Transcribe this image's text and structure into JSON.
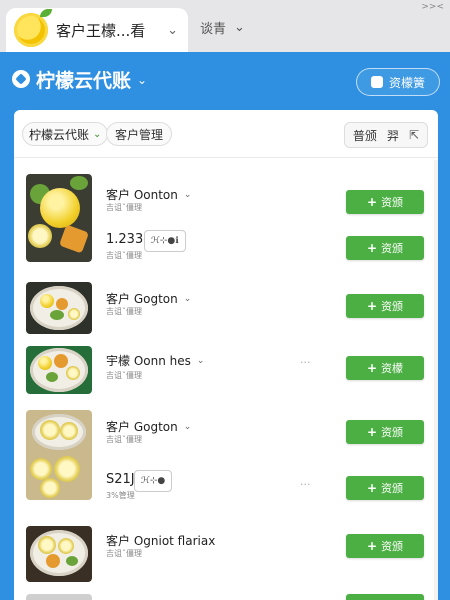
{
  "tabs": {
    "active_title": "客户王檬...看",
    "second_title": "谈青",
    "window_btn": ">><"
  },
  "header": {
    "title": "柠檬云代账",
    "action_label": "资檬簧"
  },
  "toolbar": {
    "filter_label": "柠檬云代账",
    "category_label": "客户管理",
    "sort_label": "普颁",
    "sort_extra": "羿"
  },
  "rows": [
    {
      "name": "客户 Oonton",
      "sub": "吉诅ˇ僵理",
      "button": "资颁"
    },
    {
      "num": "1.2336",
      "sub": "吉诅ˇ僵理",
      "chip": "ℋ⊹●ℹ",
      "button": "资颁"
    },
    {
      "name": "客户 Gogton",
      "sub": "吉诅ˇ僵理",
      "button": "资颁"
    },
    {
      "name": "宇檬 Oonn hes",
      "sub": "吉诅ˇ僵理",
      "more": "···",
      "button": "资檬"
    },
    {
      "name": "客户 Gogton",
      "sub": "吉诅ˇ僵理",
      "button": "资颁"
    },
    {
      "num": "S21J",
      "sub": "3%管理",
      "chip": "ℋ⊹●",
      "more": "···",
      "button": "资颁"
    },
    {
      "name": "客户 Ogniot flariax",
      "sub": "吉诅ˇ僵理",
      "button": "资颁"
    }
  ],
  "colors": {
    "brand_blue": "#2f8fe0",
    "action_green": "#4caf44",
    "lemon_yellow": "#f1cf2a"
  },
  "icons": {
    "logo": "lemon-logo",
    "sort": "sort-arrow-icon",
    "add": "plus-icon"
  }
}
